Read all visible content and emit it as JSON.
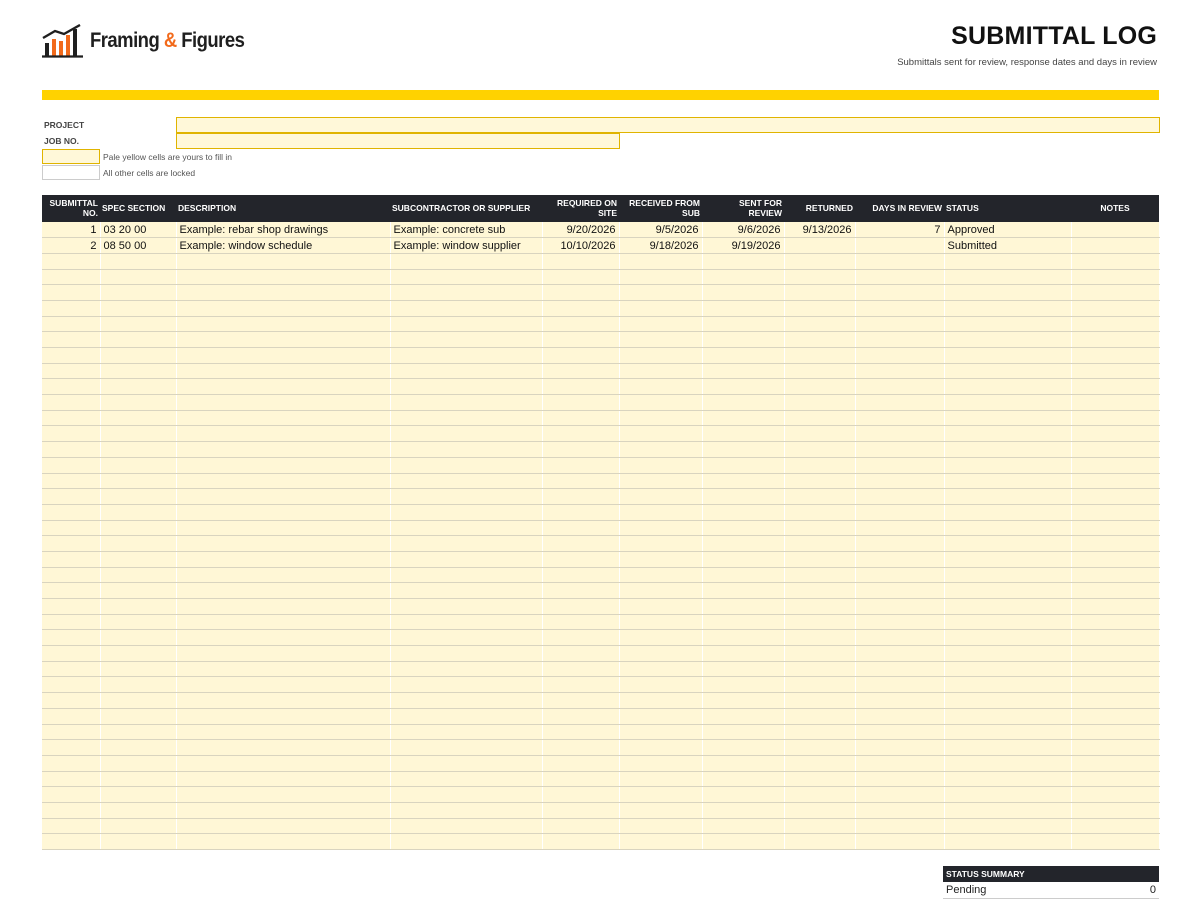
{
  "brand": {
    "name_part1": "Framing",
    "amp": "&",
    "name_part2": "Figures"
  },
  "header": {
    "title": "SUBMITTAL LOG",
    "subtitle": "Submittals sent for review, response dates and days in review"
  },
  "meta": {
    "project_label": "PROJECT",
    "project_value": "",
    "job_label": "JOB NO.",
    "job_value": "",
    "legend_fill": "Pale yellow cells are yours to fill in",
    "legend_locked": "All other cells are locked"
  },
  "colors": {
    "accent": "#ffd200",
    "input_fill": "#fff7d6",
    "header_bg": "#23252b",
    "brand_orange": "#f26a1b"
  },
  "table": {
    "columns": [
      {
        "label": "SUBMITTAL NO.",
        "align": "r"
      },
      {
        "label": "SPEC SECTION",
        "align": "l"
      },
      {
        "label": "DESCRIPTION",
        "align": "l"
      },
      {
        "label": "SUBCONTRACTOR OR SUPPLIER",
        "align": "l"
      },
      {
        "label": "REQUIRED ON SITE",
        "align": "r"
      },
      {
        "label": "RECEIVED FROM SUB",
        "align": "r"
      },
      {
        "label": "SENT FOR REVIEW",
        "align": "r"
      },
      {
        "label": "RETURNED",
        "align": "r"
      },
      {
        "label": "DAYS IN REVIEW",
        "align": "r"
      },
      {
        "label": "STATUS",
        "align": "l"
      },
      {
        "label": "NOTES",
        "align": "c"
      }
    ],
    "rows": [
      [
        "1",
        "03 20 00",
        "Example: rebar shop drawings",
        "Example: concrete sub",
        "9/20/2026",
        "9/5/2026",
        "9/6/2026",
        "9/13/2026",
        "7",
        "Approved",
        ""
      ],
      [
        "2",
        "08 50 00",
        "Example: window schedule",
        "Example: window supplier",
        "10/10/2026",
        "9/18/2026",
        "9/19/2026",
        "",
        "",
        "Submitted",
        ""
      ]
    ],
    "blank_rows": 38
  },
  "summary": {
    "header": "STATUS SUMMARY",
    "rows": [
      {
        "label": "Pending",
        "value": "0"
      }
    ]
  }
}
